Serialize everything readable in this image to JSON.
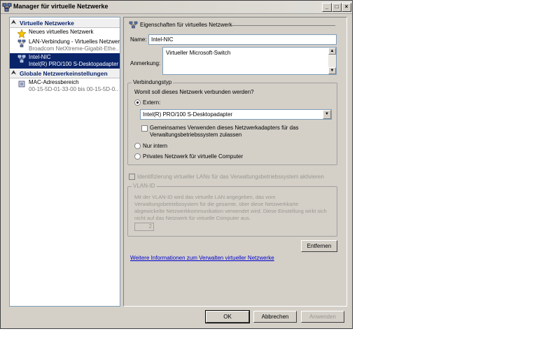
{
  "window": {
    "title": "Manager für virtuelle Netzwerke"
  },
  "tree": {
    "section_virtual": "Virtuelle Netzwerke",
    "items": [
      {
        "label": "Neues virtuelles Netzwerk",
        "sub": ""
      },
      {
        "label": "LAN-Verbindung - Virtuelles Netzwerk",
        "sub": "Broadcom NetXtreme-Gigabit-Ethe..."
      },
      {
        "label": "Intel-NIC",
        "sub": "Intel(R) PRO/100 S-Desktopadapter"
      }
    ],
    "section_global": "Globale Netzwerkeinstellungen",
    "global_items": [
      {
        "label": "MAC-Adressbereich",
        "sub": "00-15-5D-01-33-00 bis 00-15-5D-0..."
      }
    ]
  },
  "props": {
    "section_title": "Eigenschaften für virtuelles Netzwerk",
    "name_label": "Name:",
    "name_value": "Intel-NIC",
    "note_label": "Anmerkung:",
    "note_value": "Virtueller Microsoft-Switch"
  },
  "connection": {
    "group_title": "Verbindungstyp",
    "question": "Womit soll dieses Netzwerk verbunden werden?",
    "extern_label": "Extern:",
    "adapter_value": "Intel(R) PRO/100 S-Desktopadapter",
    "share_line1": "Gemeinsames Verwenden dieses Netzwerkadapters für das",
    "share_line2": "Verwaltungsbetriebssystem zulassen",
    "internal_label": "Nur intern",
    "private_label": "Privates Netzwerk für virtuelle Computer"
  },
  "vlan": {
    "check_label": "Identifizierung virtueller LANs für das Verwaltungsbetriebssystem aktivieren",
    "group_title": "VLAN-ID",
    "desc1": "Mit der VLAN-ID wird das virtuelle LAN angegeben, das vom",
    "desc2": "Verwaltungsbetriebssystem für die gesamte, über diese Netzwerkkarte",
    "desc3": "abgewickelte Netzwerkkommunikation verwendet wird. Diese Einstellung wirkt sich",
    "desc4": "nicht auf das Netzwerk für virtuelle Computer aus.",
    "id_value": "2"
  },
  "buttons": {
    "remove": "Entfernen",
    "more_info_link": "Weitere Informationen zum Verwalten virtueller Netzwerke",
    "ok": "OK",
    "cancel": "Abbrechen",
    "apply": "Anwenden"
  }
}
